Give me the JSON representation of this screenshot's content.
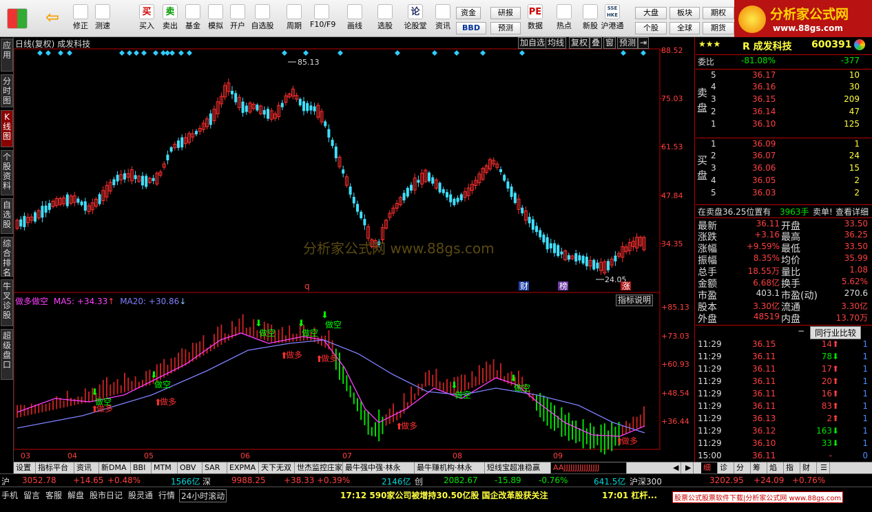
{
  "toolbar": {
    "items": [
      {
        "label": "",
        "icon": "windows-icon"
      },
      {
        "label": "",
        "icon": "back-arrow-icon"
      },
      {
        "label": "修正",
        "icon": "updown-arrow-icon"
      },
      {
        "label": "测速",
        "icon": "speed-icon"
      },
      {
        "label": "买入",
        "icon": "buy-icon",
        "glyph": "买"
      },
      {
        "label": "卖出",
        "icon": "sell-icon",
        "glyph": "卖"
      },
      {
        "label": "基金",
        "icon": "fund-icon"
      },
      {
        "label": "模拟",
        "icon": "hammer-icon"
      },
      {
        "label": "开户",
        "icon": "lock-icon"
      },
      {
        "label": "自选股",
        "icon": "star-icon"
      },
      {
        "label": "周期",
        "icon": "clock-icon"
      },
      {
        "label": "F10/F9",
        "icon": "f10-icon"
      },
      {
        "label": "画线",
        "icon": "pen-icon"
      },
      {
        "label": "选股",
        "icon": "select-icon"
      },
      {
        "label": "论股堂",
        "icon": "discuss-icon",
        "glyph": "论"
      },
      {
        "label": "资讯",
        "icon": "news-icon"
      },
      {
        "label": "数据",
        "icon": "pe-icon",
        "glyph": "PE"
      },
      {
        "label": "热点",
        "icon": "hot-icon"
      },
      {
        "label": "新股",
        "icon": "newstock-icon"
      },
      {
        "label": "沪港通",
        "icon": "hk-icon",
        "glyph": "SSE HKE"
      }
    ],
    "mini": [
      "资金",
      "研报",
      "BBD",
      "预测",
      "大盘",
      "板块",
      "期权",
      "个股",
      "全球",
      "期货"
    ]
  },
  "logo": {
    "title": "分析家公式网",
    "url": "www.88gs.com"
  },
  "lefttabs": [
    "应用",
    "分时图",
    "K线图",
    "个股资料",
    "自选股",
    "综合排名",
    "牛叉诊股",
    "超级盘口"
  ],
  "chart": {
    "title": "日线(复权)",
    "name": "成发科技",
    "buttons": [
      "加自选",
      "均线",
      "复权",
      "叠",
      "窗",
      "预测"
    ],
    "indicator": {
      "name": "做多做空",
      "ma5": "MA5: +34.33",
      "ma20": "MA20: +30.86",
      "help": "指标说明"
    },
    "watermark": "分析家公式网  www.88gs.com",
    "price_labels": [
      "88.52",
      "75.03",
      "61.53",
      "47.84",
      "34.35"
    ],
    "ind_labels": [
      "+85.13",
      "+73.03",
      "+60.93",
      "+48.54",
      "+36.44"
    ],
    "months": [
      "03",
      "04",
      "05",
      "06",
      "07",
      "08",
      "09"
    ],
    "high_label": "85.13",
    "low_label": "24.05",
    "markers": [
      "q",
      "财",
      "榜",
      "涨"
    ],
    "signal_buy": "做多",
    "signal_sell": "做空"
  },
  "quote": {
    "name": "R 成发科技",
    "code": "600391",
    "stars": "★★★",
    "weibi_label": "委比",
    "weibi": "-81.08%",
    "weicha": "-377",
    "sell_label": "卖盘",
    "buy_label": "买盘",
    "asks": [
      {
        "n": "5",
        "p": "36.17",
        "v": "10"
      },
      {
        "n": "4",
        "p": "36.16",
        "v": "30"
      },
      {
        "n": "3",
        "p": "36.15",
        "v": "209"
      },
      {
        "n": "2",
        "p": "36.14",
        "v": "47"
      },
      {
        "n": "1",
        "p": "36.10",
        "v": "125"
      }
    ],
    "bids": [
      {
        "n": "1",
        "p": "36.09",
        "v": "1"
      },
      {
        "n": "2",
        "p": "36.07",
        "v": "24"
      },
      {
        "n": "3",
        "p": "36.06",
        "v": "15"
      },
      {
        "n": "4",
        "p": "36.05",
        "v": "2"
      },
      {
        "n": "5",
        "p": "36.03",
        "v": "2"
      }
    ],
    "notice_a": "在卖盘36.25位置有",
    "notice_b": "3963手",
    "notice_c": "卖单!",
    "notice_d": "查看详细",
    "stats": [
      [
        "最新",
        "36.11",
        "开盘",
        "33.50"
      ],
      [
        "涨跌",
        "+3.16",
        "最高",
        "36.25"
      ],
      [
        "涨幅",
        "+9.59%",
        "最低",
        "33.50"
      ],
      [
        "振幅",
        "8.35%",
        "均价",
        "35.99"
      ],
      [
        "总手",
        "18.55万",
        "量比",
        "1.08"
      ],
      [
        "金额",
        "6.68亿",
        "换手",
        "5.62%"
      ],
      [
        "市盈",
        "403.1",
        "市盈(动)",
        "270.6"
      ],
      [
        "股本",
        "3.30亿",
        "流通",
        "3.30亿"
      ],
      [
        "外盘",
        "48519",
        "内盘",
        "13.70万"
      ]
    ],
    "compare": "同行业比较",
    "ticks": [
      {
        "t": "11:29",
        "p": "36.15",
        "v": "14",
        "d": "up",
        "n": "1"
      },
      {
        "t": "11:29",
        "p": "36.11",
        "v": "78",
        "d": "down",
        "n": "1"
      },
      {
        "t": "11:29",
        "p": "36.11",
        "v": "17",
        "d": "up",
        "n": "1"
      },
      {
        "t": "11:29",
        "p": "36.11",
        "v": "20",
        "d": "up",
        "n": "1"
      },
      {
        "t": "11:29",
        "p": "36.11",
        "v": "16",
        "d": "up",
        "n": "1"
      },
      {
        "t": "11:29",
        "p": "36.11",
        "v": "83",
        "d": "up",
        "n": "1"
      },
      {
        "t": "11:29",
        "p": "36.13",
        "v": "2",
        "d": "up",
        "n": "1"
      },
      {
        "t": "11:29",
        "p": "36.12",
        "v": "163",
        "d": "down",
        "n": "1"
      },
      {
        "t": "11:29",
        "p": "36.10",
        "v": "33",
        "d": "down",
        "n": "1"
      },
      {
        "t": "15:00",
        "p": "36.11",
        "v": "-",
        "d": "",
        "n": "0"
      }
    ],
    "bottomtabs": [
      "细",
      "诊",
      "分",
      "筹",
      "焰",
      "指",
      "财"
    ]
  },
  "bottomtabs": [
    "设置",
    "指标平台",
    "资讯",
    "新DMA",
    "BBI",
    "MTM",
    "OBV",
    "SAR",
    "EXPMA",
    "天下无双",
    "世杰监控庄家",
    "最牛强中强·林永",
    "最牛赚机构·林永",
    "短线宝超准稳赢",
    "AAJJJJJJJJJJJJJJJJ"
  ],
  "index": {
    "sh_label": "沪",
    "sh": "3052.78",
    "sh_chg": "+14.65",
    "sh_pct": "+0.48%",
    "sh_amt": "1566亿",
    "sz_label": "深",
    "sz": "9988.25",
    "sz_chg": "+38.33",
    "sz_pct": "+0.39%",
    "sz_amt": "2146亿",
    "cy_label": "创",
    "cy": "2082.67",
    "cy_chg": "-15.89",
    "cy_pct": "-0.76%",
    "cy_amt": "641.5亿",
    "hs_label": "沪深300",
    "hs": "3202.95",
    "hs_chg": "+24.09",
    "hs_pct": "+0.76%"
  },
  "status": {
    "items": [
      "手机",
      "留言",
      "客服",
      "解盘",
      "股市日记",
      "股灵通",
      "行情",
      "24小时滚动"
    ],
    "news1": "17:12 590家公司被增持30.50亿股 国企改革股获关注",
    "news2": "17:01 杠杆...",
    "ad": "股票公式股票软件下载|分析家公式网 www.88gs.com"
  }
}
